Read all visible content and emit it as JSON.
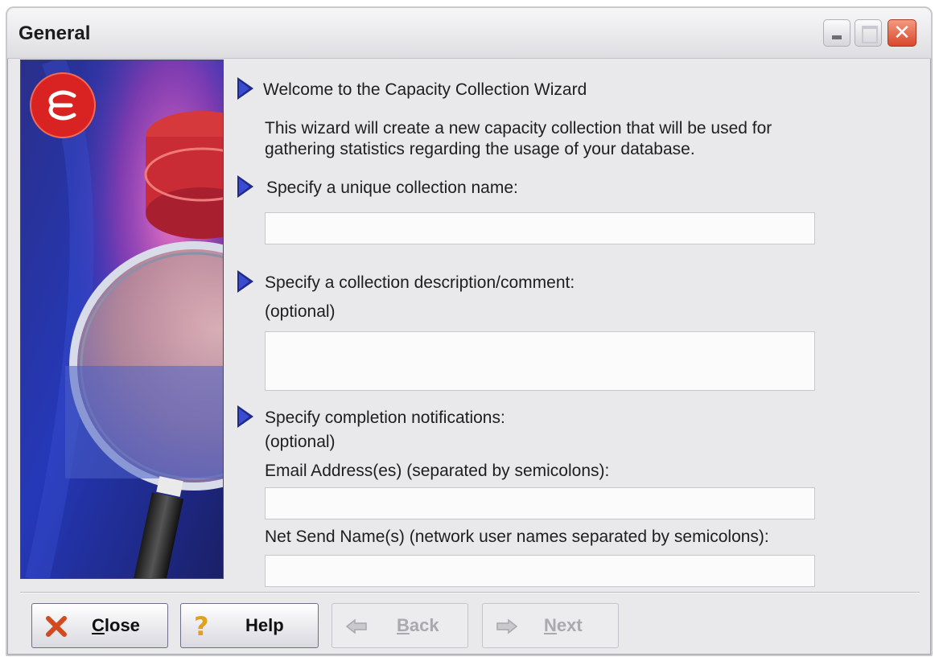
{
  "window": {
    "title": "General"
  },
  "content": {
    "section_welcome": {
      "heading": "Welcome to the Capacity Collection Wizard",
      "body_line1": "This wizard will create a new capacity collection that will be used for",
      "body_line2": "gathering statistics regarding the usage of your database."
    },
    "section_name": {
      "label": "Specify a unique collection name:",
      "value": ""
    },
    "section_description": {
      "label": "Specify a collection description/comment:",
      "optional": "(optional)",
      "value": ""
    },
    "section_notifications": {
      "label": "Specify completion notifications:",
      "optional": "(optional)",
      "email_label": "Email Address(es) (separated by semicolons):",
      "email_value": "",
      "netsend_label": "Net Send Name(s) (network user names separated by semicolons):",
      "netsend_value": ""
    }
  },
  "buttons": {
    "close": {
      "mnemonic": "C",
      "rest": "lose",
      "icon": "close-x-icon"
    },
    "help": {
      "label": "Help",
      "icon": "question-mark-icon"
    },
    "back": {
      "mnemonic": "B",
      "rest": "ack",
      "icon": "back-arrow-icon",
      "enabled": false
    },
    "next": {
      "mnemonic": "N",
      "rest": "ext",
      "icon": "next-arrow-icon",
      "enabled": false
    }
  },
  "colors": {
    "arrow": "#1f2b8a",
    "close_icon": "#d14a20",
    "help_icon": "#e0a21a"
  }
}
